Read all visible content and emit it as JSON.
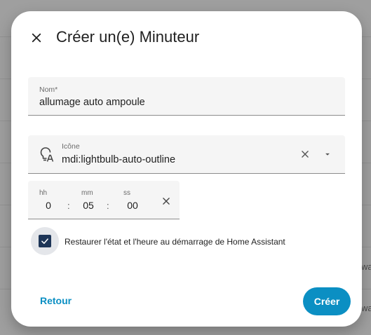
{
  "background": {
    "snippets": [
      "wa",
      "wa"
    ]
  },
  "dialog": {
    "title": "Créer un(e) Minuteur",
    "name_field": {
      "label": "Nom*",
      "value": "allumage auto ampoule"
    },
    "icon_field": {
      "label": "Icône",
      "value": "mdi:lightbulb-auto-outline"
    },
    "duration": {
      "hours_label": "hh",
      "minutes_label": "mm",
      "seconds_label": "ss",
      "hours": "0",
      "minutes": "05",
      "seconds": "00",
      "separator": ":"
    },
    "restore_checkbox": {
      "checked": true,
      "label": "Restaurer l'état et l'heure au démarrage de Home Assistant"
    },
    "actions": {
      "back_label": "Retour",
      "create_label": "Créer"
    }
  },
  "colors": {
    "accent": "#0b8fc3",
    "checkbox": "#1d3557",
    "field_bg": "#f5f5f5"
  }
}
